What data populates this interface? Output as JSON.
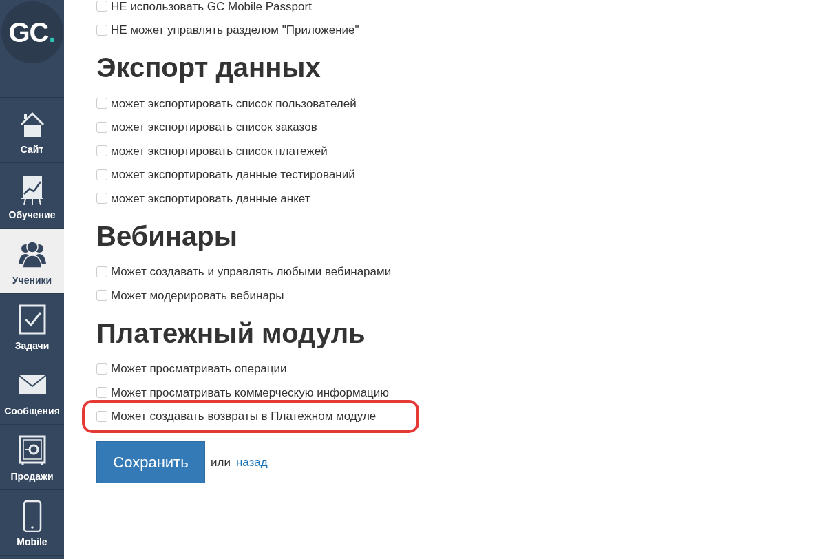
{
  "sidebar": {
    "logo": {
      "letters": "GC",
      "dot": "."
    },
    "items": [
      {
        "kind": "home",
        "label": "Сайт",
        "selected": false
      },
      {
        "kind": "chart",
        "label": "Обучение",
        "selected": false
      },
      {
        "kind": "users",
        "label": "Ученики",
        "selected": true
      },
      {
        "kind": "task",
        "label": "Задачи",
        "selected": false
      },
      {
        "kind": "mail",
        "label": "Сообщения",
        "selected": false
      },
      {
        "kind": "safe",
        "label": "Продажи",
        "selected": false
      },
      {
        "kind": "phone",
        "label": "Mobile",
        "selected": false
      }
    ]
  },
  "sections": [
    {
      "items": [
        {
          "label": "НЕ использовать GC Mobile Passport",
          "checked": false,
          "highlighted": false
        },
        {
          "label": "НЕ может управлять разделом \"Приложение\"",
          "checked": false,
          "highlighted": false
        }
      ]
    },
    {
      "title": "Экспорт данных",
      "items": [
        {
          "label": "может экспортировать список пользователей",
          "checked": false,
          "highlighted": false
        },
        {
          "label": "может экспортировать список заказов",
          "checked": false,
          "highlighted": false
        },
        {
          "label": "может экспортировать список платежей",
          "checked": false,
          "highlighted": false
        },
        {
          "label": "может экспортировать данные тестирований",
          "checked": false,
          "highlighted": false
        },
        {
          "label": "может экспортировать данные анкет",
          "checked": false,
          "highlighted": false
        }
      ]
    },
    {
      "title": "Вебинары",
      "items": [
        {
          "label": "Может создавать и управлять любыми вебинарами",
          "checked": false,
          "highlighted": false
        },
        {
          "label": "Может модерировать вебинары",
          "checked": false,
          "highlighted": false
        }
      ]
    },
    {
      "title": "Платежный модуль",
      "items": [
        {
          "label": "Может просматривать операции",
          "checked": false,
          "highlighted": false
        },
        {
          "label": "Может просматривать коммерческую информацию",
          "checked": false,
          "highlighted": false
        },
        {
          "label": "Может создавать возвраты в Платежном модуле",
          "checked": false,
          "highlighted": true
        }
      ]
    }
  ],
  "footer": {
    "save": "Сохранить",
    "or": "или",
    "back": "назад"
  }
}
